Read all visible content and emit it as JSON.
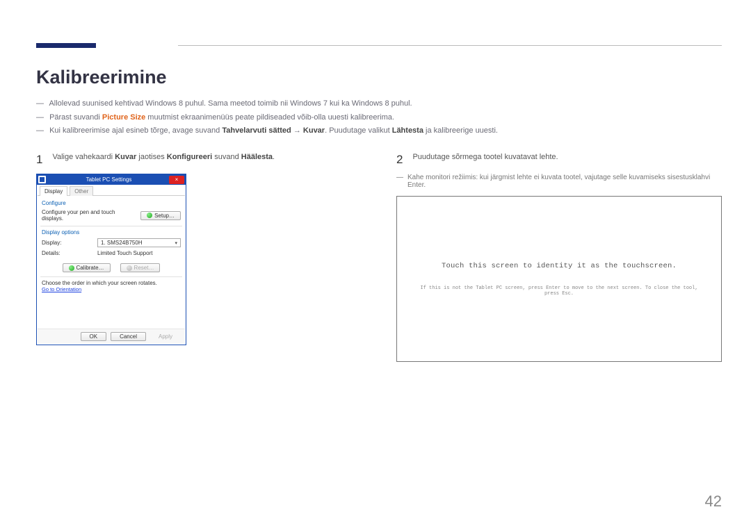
{
  "page": {
    "title": "Kalibreerimine",
    "pageNumber": "42"
  },
  "notes": {
    "n1_pre": "Allolevad suunised kehtivad Windows 8 puhul. Sama meetod toimib nii Windows 7 kui ka Windows 8 puhul.",
    "n2_pre": "Pärast suvandi ",
    "n2_bold": "Picture Size",
    "n2_post": " muutmist ekraanimenüüs peate pildiseaded võib-olla uuesti kalibreerima.",
    "n3_pre": "Kui kalibreerimise ajal esineb tõrge, avage suvand ",
    "n3_b1": "Tahvelarvuti sätted",
    "n3_arrow": " → ",
    "n3_b2": "Kuvar",
    "n3_mid": ". Puudutage valikut ",
    "n3_b3": "Lähtesta",
    "n3_post": " ja kalibreerige uuesti."
  },
  "step1": {
    "num": "1",
    "t_pre": "Valige vahekaardi ",
    "t_b1": "Kuvar",
    "t_mid": " jaotises ",
    "t_b2": "Konfigureeri",
    "t_mid2": " suvand ",
    "t_b3": "Häälesta",
    "t_post": "."
  },
  "step2": {
    "num": "2",
    "text": "Puudutage sõrmega tootel kuvatavat lehte.",
    "sub": "Kahe monitori režiimis: kui järgmist lehte ei kuvata tootel, vajutage selle kuvamiseks sisestusklahvi Enter."
  },
  "win": {
    "title": "Tablet PC Settings",
    "close": "×",
    "tab_display": "Display",
    "tab_other": "Other",
    "configure": "Configure",
    "cfg_text": "Configure your pen and touch displays.",
    "setup_btn": "Setup…",
    "display_options": "Display options",
    "display_label": "Display:",
    "display_value": "1. SMS24B750H",
    "details_label": "Details:",
    "details_value": "Limited Touch Support",
    "calibrate_btn": "Calibrate…",
    "reset_btn": "Reset…",
    "rotate_text": "Choose the order in which your screen rotates.",
    "orientation_link": "Go to Orientation",
    "ok": "OK",
    "cancel": "Cancel",
    "apply": "Apply"
  },
  "touch": {
    "main": "Touch this screen to identity it as the touchscreen.",
    "sub": "If this is not the Tablet PC screen, press Enter to move to the next screen. To close the tool, press Esc."
  }
}
